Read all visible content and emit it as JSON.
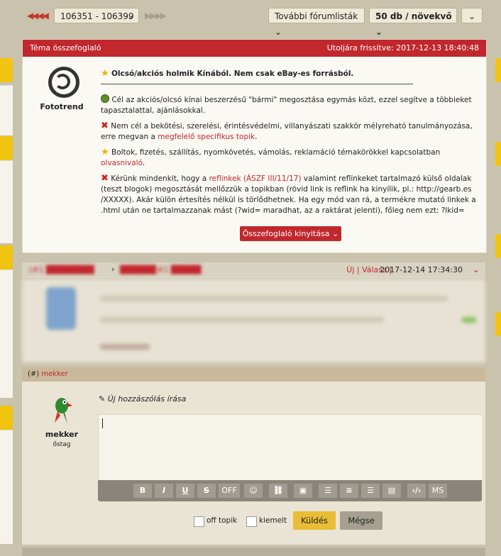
{
  "topbar": {
    "range_label": "106351 - 106399",
    "forum_lists_label": "További fórumlisták",
    "sort_label": "50 db / növekvő"
  },
  "summary": {
    "header_title": "Téma összefoglaló",
    "last_updated": "Utoljára frissítve: 2017-12-13 18:40:48",
    "author": "Fototrend",
    "title": "Olcsó/akciós holmik Kínából. Nem csak eBay-es forrásból.",
    "p1": "Cél az akciós/olcsó kínai beszerzésű \"bármi\" megosztása egymás közt, ezzel segítve a többieket tapasztalattal, ajánlásokkal.",
    "p2_pre": "Nem cél a bekötési, szerelési, érintésvédelmi, villanyászati szakkör mélyreható tanulmányozása, erre megvan a ",
    "p2_link": "megfelelő specifikus topik",
    "p2_post": ".",
    "p3_pre": "Boltok, fizetés, szállítás, nyomkövetés, vámolás, reklamáció témakörökkel kapcsolatban ",
    "p3_link": "olvasnivaló",
    "p3_post": ".",
    "p4_pre": "Kérünk mindenkit, hogy a ",
    "p4_link": "reflinkek (ÁSZF III/11/17)",
    "p4_post": " valamint reflinkeket tartalmazó külső oldalak (teszt blogok) megosztását mellőzzük a topikban (rövid link is reflink ha kinyílik, pl.: http://gearb.es /XXXXX). Akár külön értesítés nélkül is törlődhetnek. Ha egy mód van rá, a termékre mutató linkek a .html után ne tartalmazzanak mást (?wid= maradhat, az a raktárat jelenti), főleg nem ezt: ?lkid=",
    "expand_label": "Összefoglaló kinyitása"
  },
  "post": {
    "num1": "#1",
    "num2": "#1",
    "new_label": "Új",
    "reply_label": "Válasz",
    "datetime": "2017-12-14 17:34:30"
  },
  "reply": {
    "header_num": "(#)",
    "header_user": "mekker",
    "new_comment_label": "Új hozzászólás írása",
    "username": "mekker",
    "rank": "őstag",
    "toolbar": {
      "bold": "B",
      "italic": "I",
      "underline": "U",
      "strike": "S",
      "off": "OFF",
      "ms": "MS"
    },
    "offtopic_label": "off topik",
    "highlight_label": "kiemelt",
    "send_label": "Küldés",
    "cancel_label": "Mégse"
  }
}
